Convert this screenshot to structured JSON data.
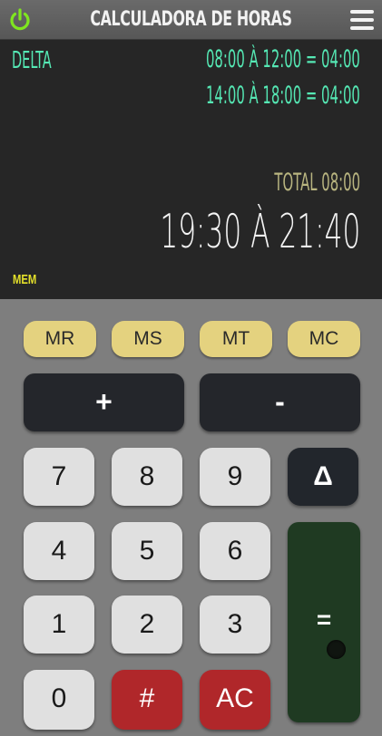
{
  "app": {
    "title": "CALCULADORA DE HORAS",
    "icons": {
      "power": "power-icon",
      "menu": "hamburger-menu-icon"
    },
    "colors": {
      "accent_green": "#55e8b4",
      "memory_yellow": "#e4d27f",
      "clear_red": "#b0272a",
      "equals_green": "#1f3a22"
    }
  },
  "display": {
    "mode": "DELTA",
    "lines": [
      "08:00 À 12:00 = 04:00",
      "14:00 À 18:00 = 04:00"
    ],
    "total": "TOTAL 08:00",
    "current": "19:30 À 21:40",
    "mem_indicator": "MEM"
  },
  "keypad": {
    "memory": [
      "MR",
      "MS",
      "MT",
      "MC"
    ],
    "plus": "+",
    "minus": "-",
    "digits": {
      "d7": "7",
      "d8": "8",
      "d9": "9",
      "d4": "4",
      "d5": "5",
      "d6": "6",
      "d1": "1",
      "d2": "2",
      "d3": "3",
      "d0": "0"
    },
    "delta": "Δ",
    "hash": "#",
    "clear": "AC",
    "equals": "="
  }
}
